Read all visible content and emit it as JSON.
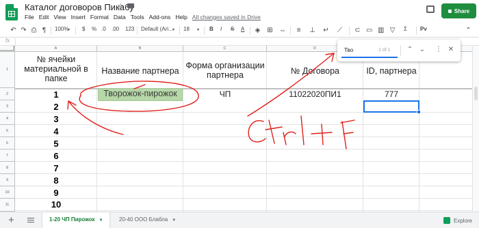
{
  "header": {
    "title": "Каталог договоров Пикабу",
    "menu": [
      "File",
      "Edit",
      "View",
      "Insert",
      "Format",
      "Data",
      "Tools",
      "Add-ons",
      "Help"
    ],
    "saved_status": "All changes saved in Drive",
    "share_label": "Share"
  },
  "toolbar": {
    "zoom": "100%",
    "currency": "$",
    "percent": "%",
    "decimal_decrease": ".0",
    "decimal_increase": ".00",
    "number_format": "123",
    "font": "Default (Ari...",
    "font_size": "18",
    "bold": "B",
    "italic": "I",
    "strike": "S",
    "text_color": "A",
    "function": "Σ",
    "input_tools": "Рv"
  },
  "formula_bar": {
    "fx_label": "fx"
  },
  "columns": [
    "A",
    "B",
    "C",
    "D",
    "E"
  ],
  "rows": [
    "1",
    "2",
    "3",
    "4",
    "5",
    "6",
    "7",
    "8",
    "9",
    "10",
    "11"
  ],
  "header_cells": {
    "a": "№ ячейки материальной в папке",
    "b": "Название партнера",
    "c": "Форма организации партнера",
    "d": "№ Договора",
    "e": "ID, партнера"
  },
  "row2": {
    "b": "Творожок-пирожок",
    "c": "ЧП",
    "d": "11022020ПИ1",
    "e": "777"
  },
  "numbers": [
    "1",
    "2",
    "3",
    "4",
    "5",
    "6",
    "7",
    "8",
    "9",
    "10"
  ],
  "find": {
    "query": "Тво",
    "count": "1 of 1"
  },
  "tabs": [
    {
      "label": "1-20 ЧП Пирожок"
    },
    {
      "label": "20-40 ООО Блабла"
    }
  ],
  "explore_label": "Explore",
  "annotation_text": "Ctrl + F",
  "colors": {
    "accent": "#1a73e8",
    "green_fill": "#b6d7a8",
    "share": "#1e8e3e",
    "annotation": "#e0201a"
  }
}
